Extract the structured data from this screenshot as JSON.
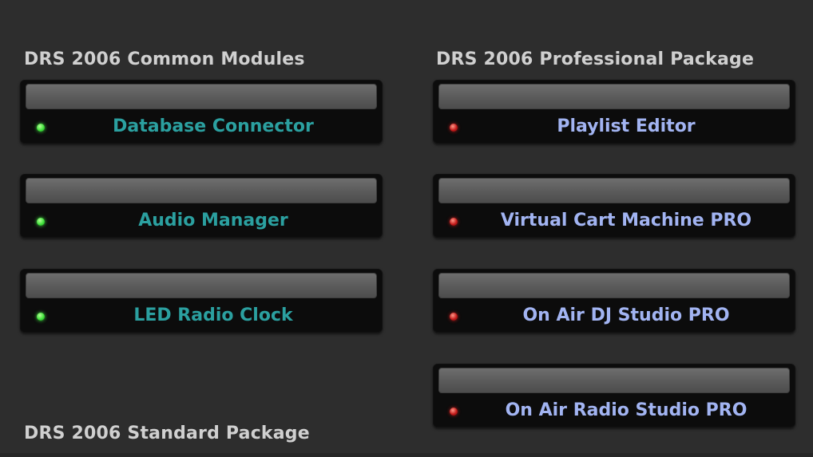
{
  "common_modules": {
    "title": "DRS 2006 Common Modules",
    "items": [
      {
        "label": "Database Connector",
        "status": "active"
      },
      {
        "label": "Audio Manager",
        "status": "active"
      },
      {
        "label": "LED Radio Clock",
        "status": "active"
      }
    ]
  },
  "professional_package": {
    "title": "DRS 2006 Professional Package",
    "items": [
      {
        "label": "Playlist Editor",
        "status": "inactive"
      },
      {
        "label": "Virtual Cart Machine PRO",
        "status": "inactive"
      },
      {
        "label": "On Air DJ Studio PRO",
        "status": "inactive"
      },
      {
        "label": "On Air Radio Studio PRO",
        "status": "inactive"
      }
    ]
  },
  "standard_package": {
    "title": "DRS 2006 Standard Package"
  },
  "colors": {
    "background": "#2d2d2d",
    "active_led": "#3ee03a",
    "inactive_led": "#c41a1a",
    "common_label": "#2ba0a0",
    "professional_label": "#a2b4f2"
  }
}
